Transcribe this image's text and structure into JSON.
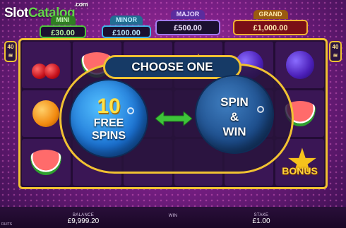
{
  "logo": {
    "part1": "Slot",
    "part2": "Catalog",
    "suffix": ".com"
  },
  "jackpots": {
    "mini": {
      "label": "MINI",
      "value": "£30.00"
    },
    "minor": {
      "label": "MINOR",
      "value": "£100.00"
    },
    "major": {
      "label": "MAJOR",
      "value": "£500.00"
    },
    "grand": {
      "label": "GRAND",
      "value": "£1,000.00"
    }
  },
  "ways_badge": {
    "number": "40",
    "unit": "≋"
  },
  "choose": {
    "title": "CHOOSE ONE",
    "option_left": {
      "number": "10",
      "line1": "FREE",
      "line2": "SPINS"
    },
    "option_right": {
      "line1": "SPIN",
      "line2": "&",
      "line3": "WIN"
    }
  },
  "reel_symbols": {
    "bonus_label": "BONUS",
    "icons": [
      "cherry-icon",
      "watermelon-icon",
      "orange-icon",
      "plum-icon",
      "star-icon"
    ]
  },
  "bottom_bar": {
    "balance_label": "BALANCE",
    "balance_value": "£9,999.20",
    "win_label": "WIN",
    "stake_label": "STAKE",
    "stake_value": "£1.00",
    "game_label": "RUITS"
  },
  "colors": {
    "gold_border": "#f1c232",
    "free_spins_orb": "#1b72d4",
    "spin_win_orb": "#1c4c8a",
    "arrow_green": "#3ec43a"
  }
}
